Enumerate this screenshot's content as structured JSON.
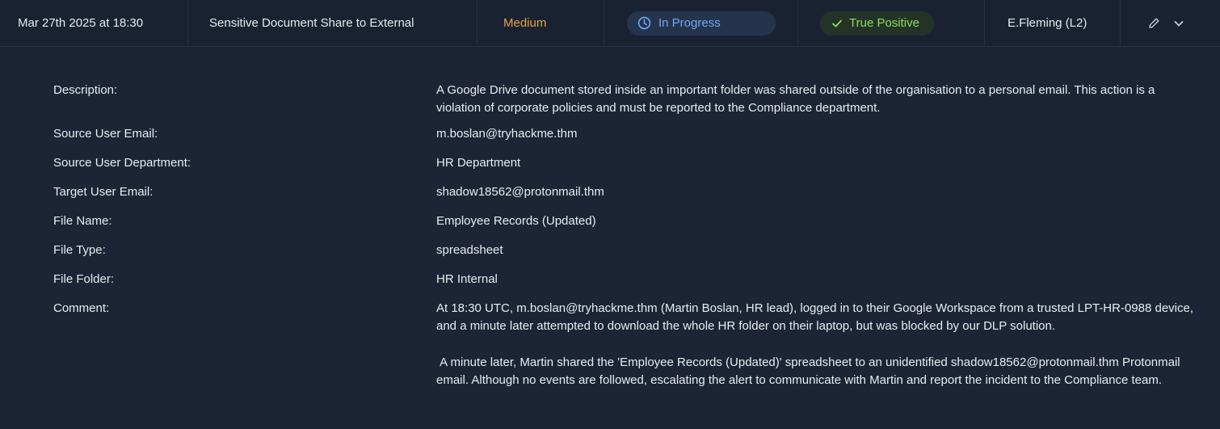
{
  "alert": {
    "datetime": "Mar 27th 2025 at 18:30",
    "title": "Sensitive Document Share to External",
    "severity": "Medium",
    "status": "In Progress",
    "verdict": "True Positive",
    "assignee": "E.Fleming (L2)",
    "icons": {
      "status": "clock-icon",
      "verdict": "check-icon",
      "edit": "pencil-icon",
      "expand": "chevron-down-icon"
    },
    "colors": {
      "severity": "#e6a23c",
      "status_text": "#6ea8f5",
      "status_bg": "#25344d",
      "verdict_text": "#8fdc5a",
      "verdict_bg": "#243327"
    }
  },
  "details": {
    "description_label": "Description:",
    "description_value": "A Google Drive document stored inside an important folder was shared outside of the organisation to a personal email. This action is a violation of corporate policies and must be reported to the Compliance department.",
    "source_email_label": "Source User Email:",
    "source_email_value": "m.boslan@tryhackme.thm",
    "source_dept_label": "Source User Department:",
    "source_dept_value": "HR Department",
    "target_email_label": "Target User Email:",
    "target_email_value": "shadow18562@protonmail.thm",
    "file_name_label": "File Name:",
    "file_name_value": "Employee Records (Updated)",
    "file_type_label": "File Type:",
    "file_type_value": "spreadsheet",
    "file_folder_label": "File Folder:",
    "file_folder_value": "HR Internal",
    "comment_label": "Comment:",
    "comment_p1": "At 18:30 UTC, m.boslan@tryhackme.thm (Martin Boslan, HR lead), logged in to their Google Workspace from a trusted LPT-HR-0988 device, and a minute later attempted to download the whole HR folder on their laptop, but was blocked by our DLP solution.",
    "comment_p2": " A minute later, Martin shared the 'Employee Records (Updated)' spreadsheet to an unidentified shadow18562@protonmail.thm Protonmail email. Although no events are followed, escalating the alert to communicate with Martin and report the incident to the Compliance team."
  }
}
